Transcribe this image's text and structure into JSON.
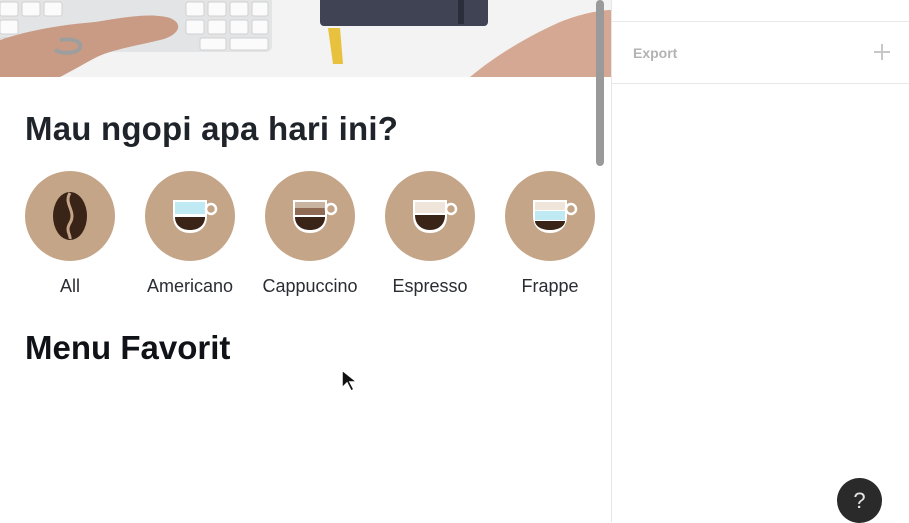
{
  "app": {
    "heading": "Mau ngopi apa hari ini?",
    "categories": [
      {
        "label": "All",
        "icon": "coffee-bean-icon"
      },
      {
        "label": "Americano",
        "icon": "americano-cup-icon"
      },
      {
        "label": "Cappuccino",
        "icon": "cappuccino-cup-icon"
      },
      {
        "label": "Espresso",
        "icon": "espresso-cup-icon"
      },
      {
        "label": "Frappe",
        "icon": "frappe-cup-icon"
      }
    ],
    "section_title": "Menu Favorit"
  },
  "panel": {
    "export_label": "Export",
    "help_label": "?"
  },
  "colors": {
    "category_circle": "#c4a587",
    "coffee": "#3a2417",
    "ice": "#bfe9f3",
    "foam": "#c8b4a1",
    "cream": "#efe5da"
  }
}
